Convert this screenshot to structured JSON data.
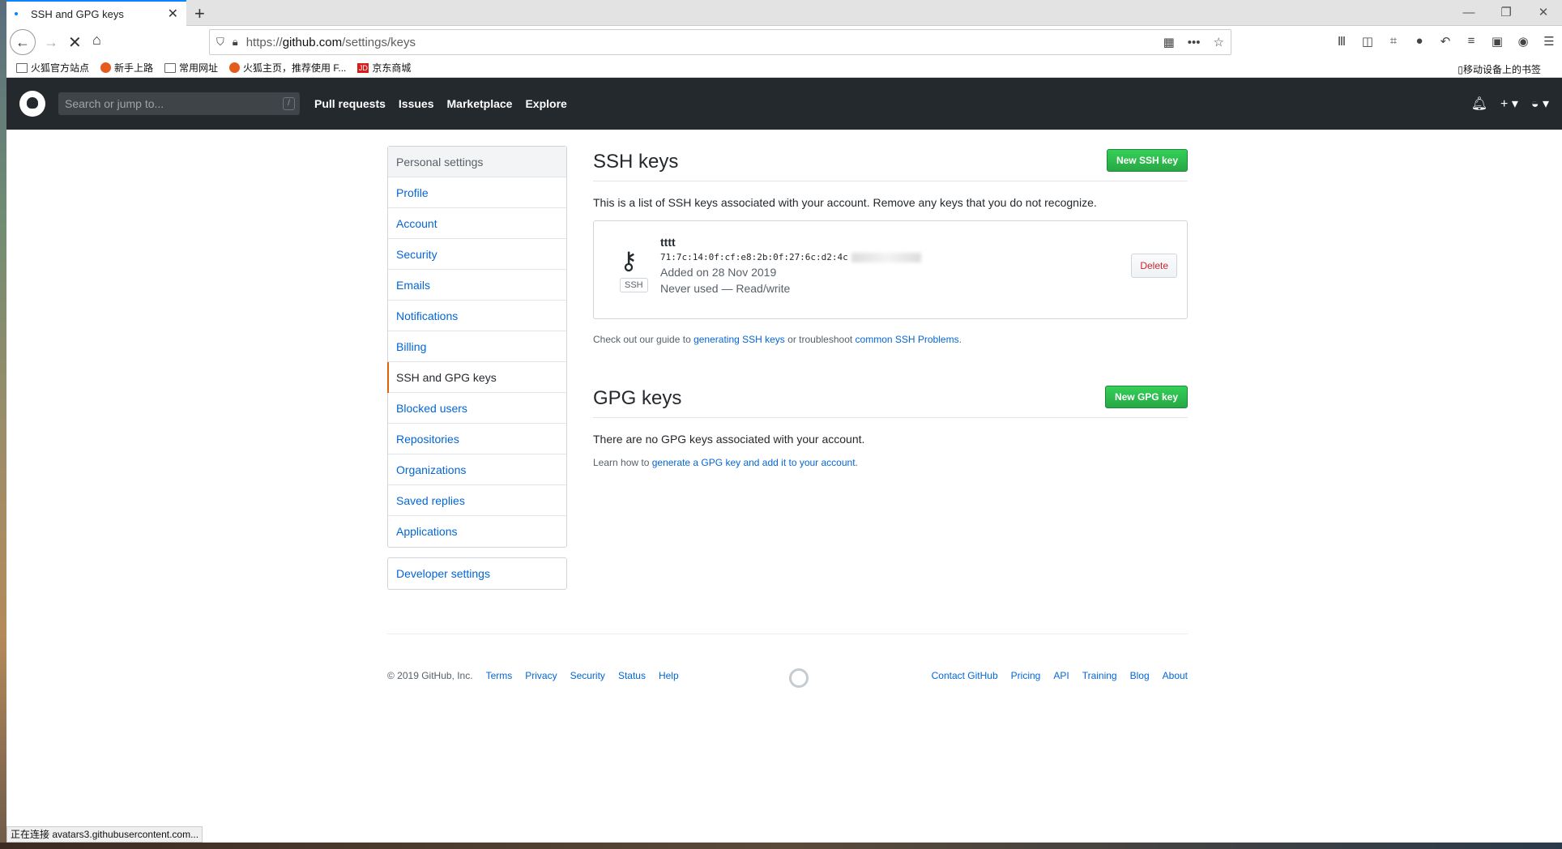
{
  "browser": {
    "tab_title": "SSH and GPG keys",
    "url_prefix": "https://",
    "url_host": "github.com",
    "url_path": "/settings/keys",
    "bookmarks": [
      "火狐官方站点",
      "新手上路",
      "常用网址",
      "火狐主页，推荐使用 F...",
      "京东商城"
    ],
    "mobile_bookmarks": "移动设备上的书签",
    "status_text": "正在连接 avatars3.githubusercontent.com..."
  },
  "header": {
    "search_placeholder": "Search or jump to...",
    "search_shortcut": "/",
    "nav": [
      "Pull requests",
      "Issues",
      "Marketplace",
      "Explore"
    ]
  },
  "sidebar": {
    "heading": "Personal settings",
    "items": [
      "Profile",
      "Account",
      "Security",
      "Emails",
      "Notifications",
      "Billing",
      "SSH and GPG keys",
      "Blocked users",
      "Repositories",
      "Organizations",
      "Saved replies",
      "Applications"
    ],
    "selected": "SSH and GPG keys",
    "developer": "Developer settings"
  },
  "ssh": {
    "title": "SSH keys",
    "new_button": "New SSH key",
    "intro": "This is a list of SSH keys associated with your account. Remove any keys that you do not recognize.",
    "key": {
      "name": "tttt",
      "fingerprint": "71:7c:14:0f:cf:e8:2b:0f:27:6c:d2:4c",
      "added": "Added on 28 Nov 2019",
      "usage": "Never used — Read/write",
      "type_label": "SSH",
      "delete_label": "Delete"
    },
    "help_prefix": "Check out our guide to ",
    "help_link1": "generating SSH keys",
    "help_mid": " or troubleshoot ",
    "help_link2": "common SSH Problems",
    "help_suffix": "."
  },
  "gpg": {
    "title": "GPG keys",
    "new_button": "New GPG key",
    "empty": "There are no GPG keys associated with your account.",
    "learn_prefix": "Learn how to ",
    "learn_link": "generate a GPG key and add it to your account",
    "learn_suffix": "."
  },
  "footer": {
    "copyright": "© 2019 GitHub, Inc.",
    "left_links": [
      "Terms",
      "Privacy",
      "Security",
      "Status",
      "Help"
    ],
    "right_links": [
      "Contact GitHub",
      "Pricing",
      "API",
      "Training",
      "Blog",
      "About"
    ]
  },
  "colors": {
    "header_bg": "#24292e",
    "link": "#0366d6",
    "green_button": "#28a745",
    "selected_accent": "#e36209",
    "delete_text": "#cb2431"
  }
}
